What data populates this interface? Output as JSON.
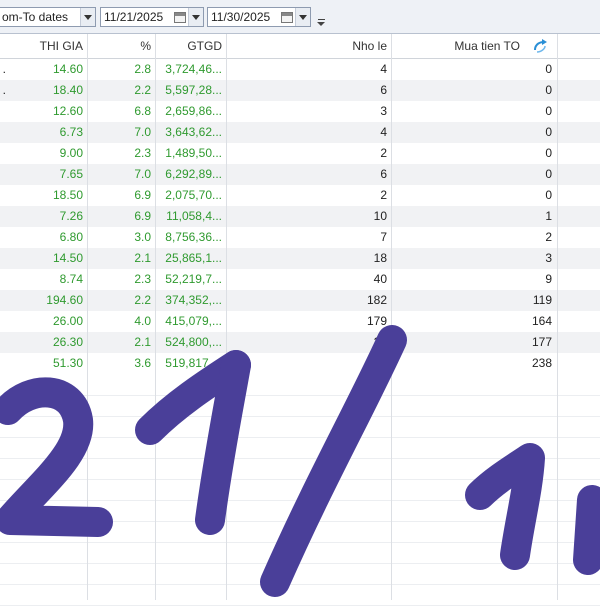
{
  "toolbar": {
    "range_label": "om-To dates",
    "from_date": "11/21/2025",
    "to_date": "11/30/2025"
  },
  "columns": [
    "THI GIA",
    "%",
    "GTGD",
    "Nho le",
    "Mua tien TO"
  ],
  "rows": [
    {
      "marker": ".",
      "price": "14.60",
      "pct": "2.8",
      "gtgd": "3,724,46...",
      "nho_le": "4",
      "mua": "0"
    },
    {
      "marker": ".",
      "price": "18.40",
      "pct": "2.2",
      "gtgd": "5,597,28...",
      "nho_le": "6",
      "mua": "0"
    },
    {
      "marker": "",
      "price": "12.60",
      "pct": "6.8",
      "gtgd": "2,659,86...",
      "nho_le": "3",
      "mua": "0"
    },
    {
      "marker": "",
      "price": "6.73",
      "pct": "7.0",
      "gtgd": "3,643,62...",
      "nho_le": "4",
      "mua": "0"
    },
    {
      "marker": "",
      "price": "9.00",
      "pct": "2.3",
      "gtgd": "1,489,50...",
      "nho_le": "2",
      "mua": "0"
    },
    {
      "marker": "",
      "price": "7.65",
      "pct": "7.0",
      "gtgd": "6,292,89...",
      "nho_le": "6",
      "mua": "0"
    },
    {
      "marker": "",
      "price": "18.50",
      "pct": "6.9",
      "gtgd": "2,075,70...",
      "nho_le": "2",
      "mua": "0"
    },
    {
      "marker": "",
      "price": "7.26",
      "pct": "6.9",
      "gtgd": "11,058,4...",
      "nho_le": "10",
      "mua": "1"
    },
    {
      "marker": "",
      "price": "6.80",
      "pct": "3.0",
      "gtgd": "8,756,36...",
      "nho_le": "7",
      "mua": "2"
    },
    {
      "marker": "",
      "price": "14.50",
      "pct": "2.1",
      "gtgd": "25,865,1...",
      "nho_le": "18",
      "mua": "3"
    },
    {
      "marker": "",
      "price": "8.74",
      "pct": "2.3",
      "gtgd": "52,219,7...",
      "nho_le": "40",
      "mua": "9"
    },
    {
      "marker": "",
      "price": "194.60",
      "pct": "2.2",
      "gtgd": "374,352,...",
      "nho_le": "182",
      "mua": "119"
    },
    {
      "marker": "",
      "price": "26.00",
      "pct": "4.0",
      "gtgd": "415,079,...",
      "nho_le": "179",
      "mua": "164"
    },
    {
      "marker": "",
      "price": "26.30",
      "pct": "2.1",
      "gtgd": "524,800,...",
      "nho_le": "21",
      "mua": "177"
    },
    {
      "marker": "",
      "price": "51.30",
      "pct": "3.6",
      "gtgd": "519,817,...",
      "nho_le": "2",
      "mua": "238"
    }
  ],
  "handwriting": "21/1",
  "colors": {
    "price_green": "#2f9a2f",
    "ink": "#4a3f99",
    "alt_row": "#f1f2f4"
  },
  "icons": {
    "sort": "sort-arrow-icon",
    "calendar": "calendar-icon",
    "dropdown": "chevron-down-icon"
  }
}
